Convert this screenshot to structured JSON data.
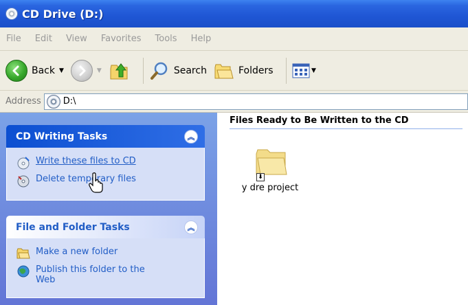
{
  "window": {
    "title": "CD Drive (D:)"
  },
  "menu": {
    "items": [
      "File",
      "Edit",
      "View",
      "Favorites",
      "Tools",
      "Help"
    ]
  },
  "toolbar": {
    "back_label": "Back",
    "search_label": "Search",
    "folders_label": "Folders"
  },
  "address": {
    "label": "Address",
    "value": "D:\\"
  },
  "sidebar": {
    "cd_tasks": {
      "title": "CD Writing Tasks",
      "items": [
        {
          "label": "Write these files to CD",
          "icon": "cd-write-icon"
        },
        {
          "label": "Delete temporary files",
          "icon": "cd-delete-icon"
        }
      ]
    },
    "file_tasks": {
      "title": "File and Folder Tasks",
      "items": [
        {
          "label": "Make a new folder",
          "icon": "new-folder-icon"
        },
        {
          "label": "Publish this folder to the Web",
          "icon": "publish-web-icon"
        }
      ]
    }
  },
  "main": {
    "group_title": "Files Ready to Be Written to the CD",
    "items": [
      {
        "name": "y dre project",
        "icon": "folder-icon"
      }
    ]
  },
  "colors": {
    "title_bar": "#1f56d4",
    "sidebar_bg": "#7ba2e7",
    "link": "#215dc6"
  }
}
